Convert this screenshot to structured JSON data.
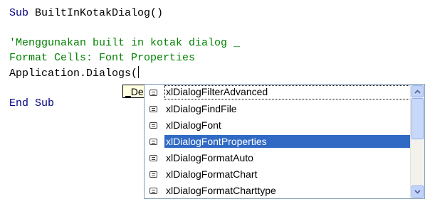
{
  "editor": {
    "line1": {
      "keyword": "Sub",
      "text": " BuiltInKotakDialog()"
    },
    "line2": "'Menggunakan built in kotak dialog _",
    "line3": "Format Cells: Font Properties",
    "line4": "Application.Dialogs(",
    "line5": {
      "keyword": "End Sub"
    }
  },
  "tooltip": {
    "prefix": "_",
    "text": "Defau"
  },
  "autocomplete": {
    "items": [
      {
        "label": "xlDialogFilterAdvanced",
        "icon": "enum-constant-icon"
      },
      {
        "label": "xlDialogFindFile",
        "icon": "enum-constant-icon"
      },
      {
        "label": "xlDialogFont",
        "icon": "enum-constant-icon"
      },
      {
        "label": "xlDialogFontProperties",
        "icon": "enum-constant-icon",
        "selected": true
      },
      {
        "label": "xlDialogFormatAuto",
        "icon": "enum-constant-icon"
      },
      {
        "label": "xlDialogFormatChart",
        "icon": "enum-constant-icon"
      },
      {
        "label": "xlDialogFormatCharttype",
        "icon": "enum-constant-icon"
      }
    ],
    "selected_color": "#316ac5"
  },
  "colors": {
    "keyword": "#000080",
    "comment": "#008000",
    "tooltip_bg": "#ffffe1"
  }
}
